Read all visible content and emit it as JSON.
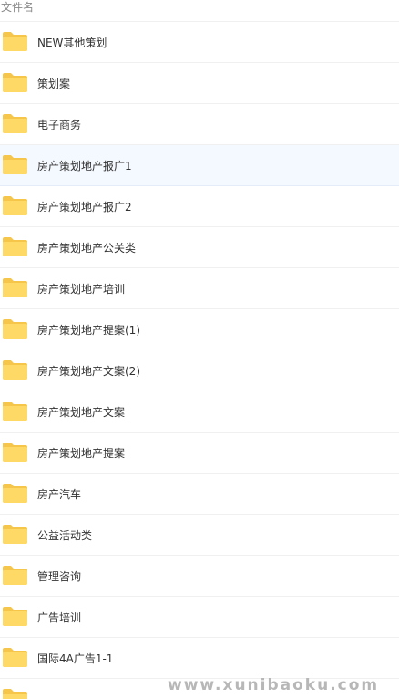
{
  "header": {
    "column_name": "文件名"
  },
  "files": [
    {
      "name": "NEW其他策划",
      "icon": "folder-icon",
      "selected": false
    },
    {
      "name": "策划案",
      "icon": "folder-icon",
      "selected": false
    },
    {
      "name": "电子商务",
      "icon": "folder-icon",
      "selected": false
    },
    {
      "name": "房产策划地产报广1",
      "icon": "folder-icon",
      "selected": true
    },
    {
      "name": "房产策划地产报广2",
      "icon": "folder-icon",
      "selected": false
    },
    {
      "name": "房产策划地产公关类",
      "icon": "folder-icon",
      "selected": false
    },
    {
      "name": "房产策划地产培训",
      "icon": "folder-icon",
      "selected": false
    },
    {
      "name": "房产策划地产提案(1)",
      "icon": "folder-icon",
      "selected": false
    },
    {
      "name": "房产策划地产文案(2)",
      "icon": "folder-icon",
      "selected": false
    },
    {
      "name": "房产策划地产文案",
      "icon": "folder-icon",
      "selected": false
    },
    {
      "name": "房产策划地产提案",
      "icon": "folder-icon",
      "selected": false
    },
    {
      "name": "房产汽车",
      "icon": "folder-icon",
      "selected": false
    },
    {
      "name": "公益活动类",
      "icon": "folder-icon",
      "selected": false
    },
    {
      "name": "管理咨询",
      "icon": "folder-icon",
      "selected": false
    },
    {
      "name": "广告培训",
      "icon": "folder-icon",
      "selected": false
    },
    {
      "name": "国际4A广告1-1",
      "icon": "folder-icon",
      "selected": false
    },
    {
      "name": "",
      "icon": "folder-icon",
      "selected": false
    }
  ],
  "watermark": "www.xunibaoku.com",
  "colors": {
    "folder_back": "#f6c64b",
    "folder_front": "#ffd965",
    "selected_row": "#f4f8ff",
    "text": "#333333",
    "header_text": "#888888"
  }
}
